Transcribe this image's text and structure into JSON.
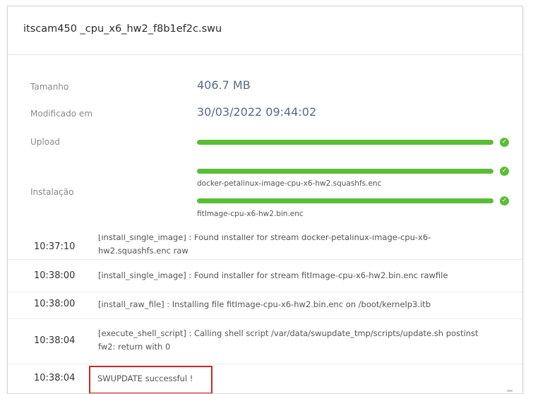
{
  "dialog": {
    "file_name": "itscam450 _cpu_x6_hw2_f8b1ef2c.swu"
  },
  "details": {
    "size_label": "Tamanho",
    "size_value": "406.7 MB",
    "modified_label": "Modificado em",
    "modified_value": "30/03/2022 09:44:02",
    "upload_label": "Upload",
    "upload_progress": 1.0,
    "install_label": "Instalação",
    "install_streams": [
      {
        "name": "docker-petalinux-image-cpu-x6-hw2.squashfs.enc",
        "progress": 1.0
      },
      {
        "name": "fitImage-cpu-x6-hw2.bin.enc",
        "progress": 1.0
      }
    ]
  },
  "log": [
    {
      "time": "10:37:10",
      "message": "[install_single_image] : Found installer for stream docker-petalinux-image-cpu-x6-hw2.squashfs.enc raw"
    },
    {
      "time": "10:38:00",
      "message": "[install_single_image] : Found installer for stream fitImage-cpu-x6-hw2.bin.enc rawfile"
    },
    {
      "time": "10:38:00",
      "message": "[install_raw_file] : Installing file fitImage-cpu-x6-hw2.bin.enc on /boot/kernelp3.itb"
    },
    {
      "time": "10:38:04",
      "message": "[execute_shell_script] : Calling shell script /var/data/swupdate_tmp/scripts/update.sh postinst fw2: return with 0"
    },
    {
      "time": "10:38:04",
      "message": "SWUPDATE successful !"
    }
  ],
  "colors": {
    "progress_fill": "#5bbd35",
    "highlight_border": "#c62828"
  },
  "icons": {
    "complete": "check-circle-icon"
  }
}
